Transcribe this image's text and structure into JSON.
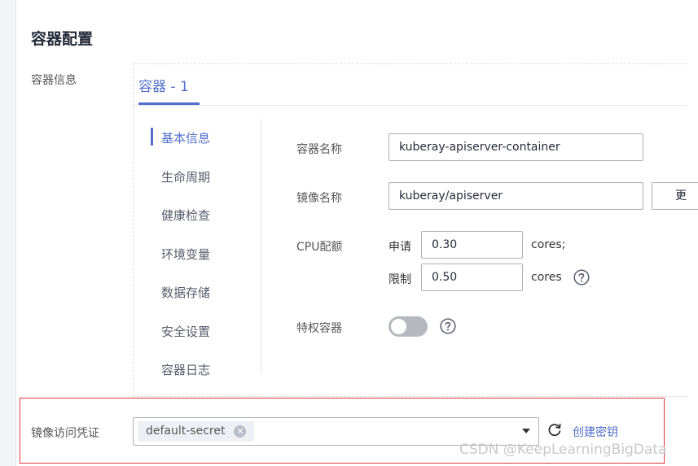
{
  "section": {
    "title": "容器配置",
    "container_info_label": "容器信息",
    "image_secret_label": "镜像访问凭证"
  },
  "tabs": [
    {
      "label": "容器 - 1"
    }
  ],
  "side_nav": [
    {
      "label": "基本信息",
      "active": true
    },
    {
      "label": "生命周期"
    },
    {
      "label": "健康检查"
    },
    {
      "label": "环境变量"
    },
    {
      "label": "数据存储"
    },
    {
      "label": "安全设置"
    },
    {
      "label": "容器日志"
    }
  ],
  "form": {
    "container_name_label": "容器名称",
    "container_name_value": "kuberay-apiserver-container",
    "image_name_label": "镜像名称",
    "image_name_value": "kuberay/apiserver",
    "image_button": "更",
    "cpu_label": "CPU配额",
    "request_label": "申请",
    "request_value": "0.30",
    "request_unit": "cores;",
    "limit_label": "限制",
    "limit_value": "0.50",
    "limit_unit": "cores",
    "privileged_label": "特权容器",
    "privileged_on": false
  },
  "secret": {
    "tag": "default-secret",
    "create_link": "创建密钥"
  },
  "watermark": "CSDN @KeepLearningBigData",
  "colors": {
    "accent": "#526ecc",
    "highlight_border": "#e0393e"
  }
}
